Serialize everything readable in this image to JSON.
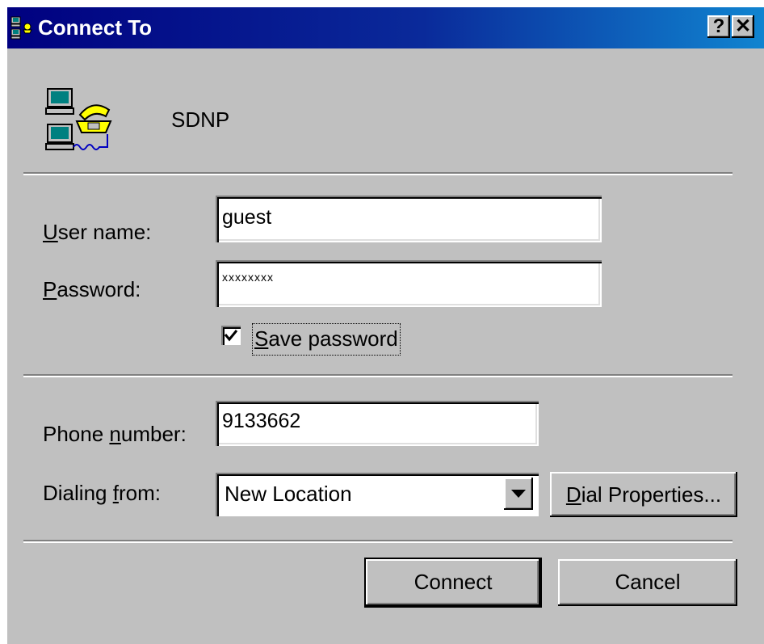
{
  "window": {
    "title": "Connect To",
    "help_button": "?",
    "close_button": "✕"
  },
  "connection": {
    "name": "SDNP",
    "icon": "dialup-connection-icon"
  },
  "form": {
    "user_name": {
      "label_prefix": "",
      "label_key": "U",
      "label_rest": "ser name:",
      "value": "guest"
    },
    "password": {
      "label_prefix": "",
      "label_key": "P",
      "label_rest": "assword:",
      "value": "xxxxxxxx"
    },
    "save_password": {
      "label_prefix": "",
      "label_key": "S",
      "label_rest": "ave password",
      "checked": true
    },
    "phone_number": {
      "label_prefix": "Phone ",
      "label_key": "n",
      "label_rest": "umber:",
      "value": "9133662"
    },
    "dialing_from": {
      "label_prefix": "Dialing ",
      "label_key": "f",
      "label_rest": "rom:",
      "value": "New Location"
    }
  },
  "buttons": {
    "dial_properties": {
      "key": "D",
      "rest": "ial Properties..."
    },
    "connect": "Connect",
    "cancel": "Cancel"
  },
  "colors": {
    "titlebar_start": "#000080",
    "titlebar_end": "#1084d0",
    "dialog_bg": "#c0c0c0"
  }
}
